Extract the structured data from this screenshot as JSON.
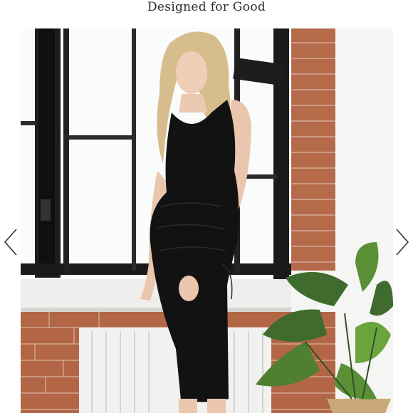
{
  "header": {
    "title": "Designed for Good"
  },
  "carousel": {
    "prev_icon": "chevron-left-icon",
    "next_icon": "chevron-right-icon",
    "slide": {
      "subject": "product-photo-black-maternity-dress"
    }
  },
  "colors": {
    "title_text": "#2b2b2b",
    "arrow": "#333333",
    "window_frame": "#1c1c1c",
    "brick": "#b36a4a",
    "dress": "#121212",
    "wall": "#f4f4f2"
  }
}
